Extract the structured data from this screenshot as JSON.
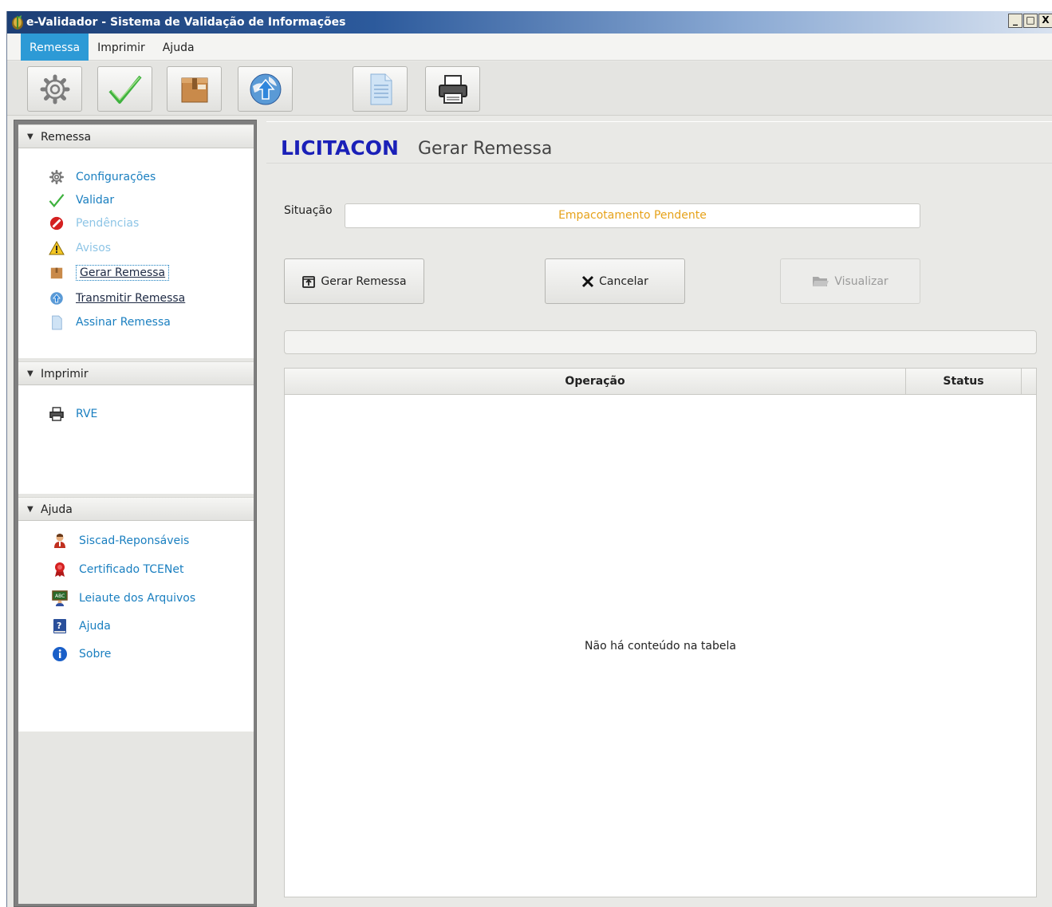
{
  "window": {
    "title": "e-Validador - Sistema de Validação de Informações",
    "controls": {
      "minimize": "_",
      "maximize": "□",
      "close": "X"
    }
  },
  "menu": {
    "items": [
      "Remessa",
      "Imprimir",
      "Ajuda"
    ],
    "active": "Remessa"
  },
  "toolbar": {
    "buttons": [
      {
        "icon": "gear-icon"
      },
      {
        "icon": "checkmark-icon"
      },
      {
        "icon": "package-icon"
      },
      {
        "icon": "globe-upload-icon"
      },
      {
        "icon": "document-icon"
      },
      {
        "icon": "printer-icon"
      }
    ]
  },
  "sidebar": {
    "remessa": {
      "header": "Remessa",
      "items": [
        {
          "label": "Configurações",
          "icon": "gear-icon"
        },
        {
          "label": "Validar",
          "icon": "checkmark-icon"
        },
        {
          "label": "Pendências",
          "icon": "no-entry-icon"
        },
        {
          "label": "Avisos",
          "icon": "warning-icon"
        },
        {
          "label": "Gerar Remessa",
          "icon": "package-icon"
        },
        {
          "label": "Transmitir Remessa",
          "icon": "globe-icon"
        },
        {
          "label": "Assinar Remessa",
          "icon": "document-icon"
        }
      ]
    },
    "imprimir": {
      "header": "Imprimir",
      "items": [
        {
          "label": "RVE",
          "icon": "printer-icon"
        }
      ]
    },
    "ajuda": {
      "header": "Ajuda",
      "items": [
        {
          "label": "Siscad-Reponsáveis",
          "icon": "person-icon"
        },
        {
          "label": "Certificado TCENet",
          "icon": "ribbon-icon"
        },
        {
          "label": "Leiaute dos Arquivos",
          "icon": "chalkboard-icon"
        },
        {
          "label": "Ajuda",
          "icon": "help-book-icon"
        },
        {
          "label": "Sobre",
          "icon": "info-icon"
        }
      ]
    }
  },
  "main": {
    "brand": "LICITACON",
    "title": "Gerar Remessa",
    "situacao_label": "Situação",
    "situacao_value": "Empacotamento Pendente",
    "situacao_color": "#e6a21a",
    "buttons": {
      "gerar": "Gerar Remessa",
      "cancelar": "Cancelar",
      "visualizar": "Visualizar"
    },
    "table": {
      "columns": [
        "Operação",
        "Status"
      ],
      "empty_message": "Não há conteúdo na tabela"
    }
  }
}
